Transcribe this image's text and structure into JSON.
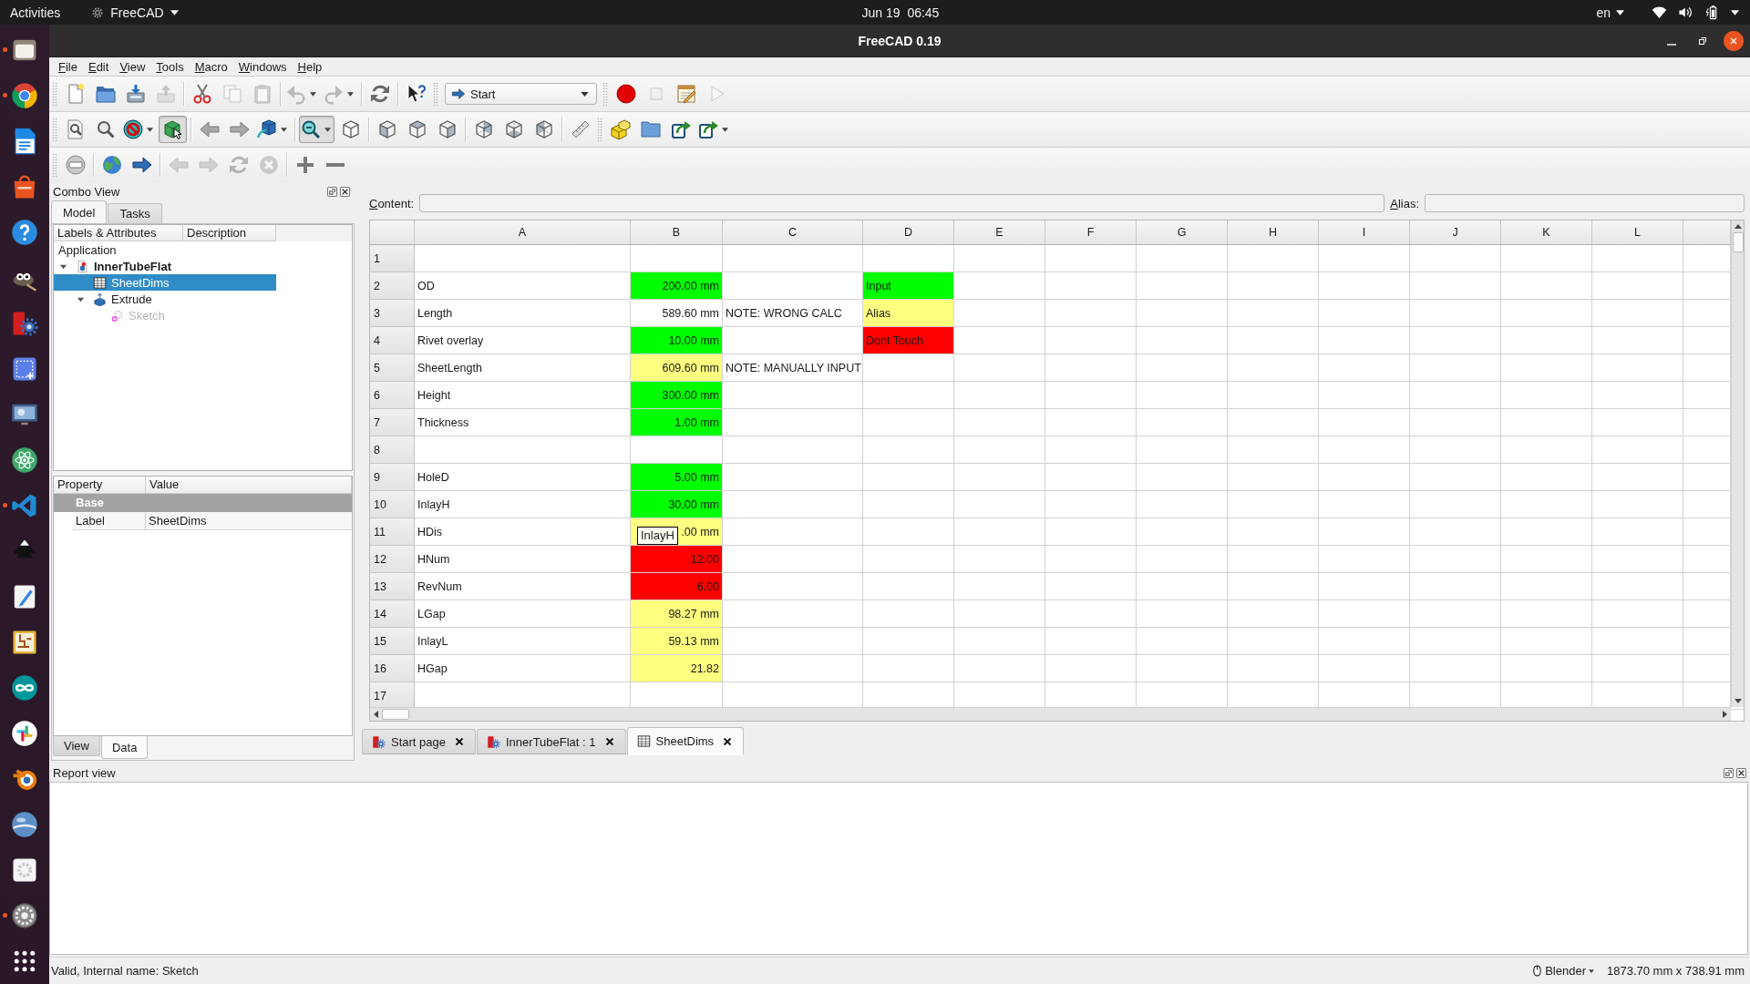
{
  "topbar": {
    "activities": "Activities",
    "app_menu": "FreeCAD",
    "clock": "Jun 19  06:45",
    "language": "en"
  },
  "dock": [
    {
      "kind": "files",
      "running": true
    },
    {
      "kind": "browser",
      "running": true
    },
    {
      "kind": "writer",
      "running": false
    },
    {
      "kind": "software",
      "running": false
    },
    {
      "kind": "help",
      "running": false
    },
    {
      "kind": "gimp",
      "running": false
    },
    {
      "kind": "freecad",
      "running": false
    },
    {
      "kind": "screenshot",
      "running": false
    },
    {
      "kind": "remote",
      "running": false
    },
    {
      "kind": "atom",
      "running": false
    },
    {
      "kind": "vscode",
      "running": true
    },
    {
      "kind": "inkscape",
      "running": false
    },
    {
      "kind": "editor",
      "running": false
    },
    {
      "kind": "kicad",
      "running": false
    },
    {
      "kind": "arduino",
      "running": false
    },
    {
      "kind": "slack",
      "running": false
    },
    {
      "kind": "blender",
      "running": false
    },
    {
      "kind": "earth",
      "running": false
    },
    {
      "kind": "gearbox",
      "running": false
    },
    {
      "kind": "settings",
      "running": true
    },
    {
      "kind": "apps",
      "running": false
    }
  ],
  "window": {
    "title": "FreeCAD 0.19"
  },
  "menu": [
    "File",
    "Edit",
    "View",
    "Tools",
    "Macro",
    "Windows",
    "Help"
  ],
  "toolbar_rows": [
    [
      {
        "groups": [
          [
            {
              "kind": "new",
              "disabled": false,
              "pressed": false,
              "menu": false
            },
            {
              "kind": "open",
              "disabled": false,
              "pressed": false,
              "menu": false
            },
            {
              "kind": "save",
              "disabled": false,
              "pressed": false,
              "menu": false
            },
            {
              "kind": "export",
              "disabled": true,
              "pressed": false,
              "menu": false
            }
          ],
          [
            {
              "kind": "cut",
              "disabled": false,
              "pressed": false,
              "menu": false
            },
            {
              "kind": "copy",
              "disabled": true,
              "pressed": false,
              "menu": false
            },
            {
              "kind": "paste",
              "disabled": true,
              "pressed": false,
              "menu": false
            }
          ],
          [
            {
              "kind": "undo",
              "disabled": true,
              "pressed": false,
              "menu": true
            },
            {
              "kind": "redo",
              "disabled": true,
              "pressed": false,
              "menu": true
            }
          ],
          [
            {
              "kind": "refresh",
              "disabled": false,
              "pressed": false,
              "menu": false
            }
          ],
          [
            {
              "kind": "whats-this",
              "disabled": false,
              "pressed": false,
              "menu": false
            }
          ]
        ]
      },
      {
        "groups": [
          [
            {
              "kind": "combo",
              "value": "Start"
            }
          ]
        ]
      },
      {
        "groups": [
          [
            {
              "kind": "record",
              "disabled": false,
              "pressed": false,
              "menu": false
            },
            {
              "kind": "stop",
              "disabled": true,
              "pressed": false,
              "menu": false
            },
            {
              "kind": "macro-edit",
              "disabled": false,
              "pressed": false,
              "menu": false
            },
            {
              "kind": "play",
              "disabled": true,
              "pressed": false,
              "menu": false
            }
          ]
        ]
      }
    ],
    [
      {
        "groups": [
          [
            {
              "kind": "fit-all",
              "disabled": false,
              "pressed": false,
              "menu": false
            },
            {
              "kind": "fit-selection",
              "disabled": false,
              "pressed": false,
              "menu": false
            },
            {
              "kind": "draw-style",
              "disabled": false,
              "pressed": false,
              "menu": true
            },
            {
              "kind": "bounding-box",
              "disabled": false,
              "pressed": true,
              "menu": false
            }
          ],
          [
            {
              "kind": "back",
              "disabled": false,
              "pressed": false,
              "menu": false
            },
            {
              "kind": "forward",
              "disabled": false,
              "pressed": false,
              "menu": false
            },
            {
              "kind": "std-views",
              "disabled": false,
              "pressed": false,
              "menu": true
            }
          ],
          [
            {
              "kind": "zoom",
              "disabled": false,
              "pressed": true,
              "menu": true
            },
            {
              "kind": "isometric",
              "disabled": false,
              "pressed": false,
              "menu": false
            }
          ],
          [
            {
              "kind": "front",
              "disabled": false,
              "pressed": false,
              "menu": false
            },
            {
              "kind": "top",
              "disabled": false,
              "pressed": false,
              "menu": false
            },
            {
              "kind": "right",
              "disabled": false,
              "pressed": false,
              "menu": false
            }
          ],
          [
            {
              "kind": "rear",
              "disabled": false,
              "pressed": false,
              "menu": false
            },
            {
              "kind": "bottom",
              "disabled": false,
              "pressed": false,
              "menu": false
            },
            {
              "kind": "left",
              "disabled": false,
              "pressed": false,
              "menu": false
            }
          ],
          [
            {
              "kind": "measure",
              "disabled": false,
              "pressed": false,
              "menu": false
            }
          ]
        ]
      },
      {
        "groups": [
          [
            {
              "kind": "part",
              "disabled": false,
              "pressed": false,
              "menu": false
            },
            {
              "kind": "group",
              "disabled": false,
              "pressed": false,
              "menu": false
            },
            {
              "kind": "link",
              "disabled": false,
              "pressed": false,
              "menu": false
            },
            {
              "kind": "link-actions",
              "disabled": false,
              "pressed": false,
              "menu": true
            }
          ]
        ]
      }
    ],
    [
      {
        "groups": [
          [
            {
              "kind": "web-view",
              "disabled": false,
              "pressed": false,
              "menu": false
            }
          ],
          [
            {
              "kind": "globe",
              "disabled": false,
              "pressed": false,
              "menu": false
            },
            {
              "kind": "set-url",
              "disabled": false,
              "pressed": false,
              "menu": false
            }
          ],
          [
            {
              "kind": "web-back",
              "disabled": true,
              "pressed": false,
              "menu": false
            },
            {
              "kind": "web-forward",
              "disabled": true,
              "pressed": false,
              "menu": false
            },
            {
              "kind": "web-refresh",
              "disabled": true,
              "pressed": false,
              "menu": false
            },
            {
              "kind": "web-stop",
              "disabled": true,
              "pressed": false,
              "menu": false
            }
          ],
          [
            {
              "kind": "zoom-in",
              "disabled": false,
              "pressed": false,
              "menu": false
            },
            {
              "kind": "zoom-out",
              "disabled": false,
              "pressed": false,
              "menu": false
            }
          ]
        ]
      }
    ]
  ],
  "combo_view": {
    "title": "Combo View",
    "tabs": [
      {
        "label": "Model",
        "selected": true
      },
      {
        "label": "Tasks",
        "selected": false
      }
    ],
    "tree": {
      "columns": [
        "Labels & Attributes",
        "Description"
      ],
      "root": "Application",
      "items": [
        {
          "label": "InnerTubeFlat",
          "kind": "document",
          "expanded": true,
          "selected": false,
          "hidden": false,
          "children": [
            {
              "label": "SheetDims",
              "kind": "spreadsheet",
              "selected": true,
              "hidden": false
            },
            {
              "label": "Extrude",
              "kind": "extrude",
              "expanded": true,
              "selected": false,
              "hidden": false,
              "children": [
                {
                  "label": "Sketch",
                  "kind": "sketch",
                  "selected": false,
                  "hidden": true
                }
              ]
            }
          ]
        }
      ]
    },
    "properties": {
      "columns": [
        "Property",
        "Value"
      ],
      "groups": [
        {
          "name": "Base",
          "rows": [
            {
              "name": "Label",
              "value": "SheetDims"
            }
          ]
        }
      ]
    },
    "bottom_tabs": [
      {
        "label": "View",
        "selected": false
      },
      {
        "label": "Data",
        "selected": true
      }
    ]
  },
  "spreadsheet": {
    "content_label": "Content:",
    "alias_label": "Alias:",
    "columns": [
      "A",
      "B",
      "C",
      "D",
      "E",
      "F",
      "G",
      "H",
      "I",
      "J",
      "K",
      "L"
    ],
    "rows": [
      {
        "number": "1"
      },
      {
        "number": "2",
        "a": {
          "text": "OD",
          "kind": "text"
        },
        "b": {
          "text": "200.00 mm",
          "kind": "number",
          "color": "#00ff00"
        },
        "d": {
          "text": "Input",
          "kind": "text",
          "color": "#00ff00"
        }
      },
      {
        "number": "3",
        "a": {
          "text": "Length",
          "kind": "text"
        },
        "b": {
          "text": "589.60 mm",
          "kind": "number"
        },
        "c": {
          "text": "NOTE: WRONG CALC",
          "kind": "text"
        },
        "d": {
          "text": "Alias",
          "kind": "text",
          "color": "#ffff80"
        }
      },
      {
        "number": "4",
        "a": {
          "text": "Rivet overlay",
          "kind": "text"
        },
        "b": {
          "text": "10.00 mm",
          "kind": "number",
          "color": "#00ff00"
        },
        "d": {
          "text": "Dont Touch",
          "kind": "text",
          "color": "#ff0000"
        }
      },
      {
        "number": "5",
        "a": {
          "text": "SheetLength",
          "kind": "text"
        },
        "b": {
          "text": "609.60 mm",
          "kind": "number",
          "color": "#ffff80"
        },
        "c": {
          "text": "NOTE: MANUALLY INPUT",
          "kind": "text"
        }
      },
      {
        "number": "6",
        "a": {
          "text": "Height",
          "kind": "text"
        },
        "b": {
          "text": "300.00 mm",
          "kind": "number",
          "color": "#00ff00"
        }
      },
      {
        "number": "7",
        "a": {
          "text": "Thickness",
          "kind": "text"
        },
        "b": {
          "text": "1.00 mm",
          "kind": "number",
          "color": "#00ff00"
        }
      },
      {
        "number": "8"
      },
      {
        "number": "9",
        "a": {
          "text": "HoleD",
          "kind": "text"
        },
        "b": {
          "text": "5.00 mm",
          "kind": "number",
          "color": "#00ff00"
        }
      },
      {
        "number": "10",
        "a": {
          "text": "InlayH",
          "kind": "text"
        },
        "b": {
          "text": "30.00 mm",
          "kind": "number",
          "color": "#00ff00"
        }
      },
      {
        "number": "11",
        "a": {
          "text": "HDis",
          "kind": "text"
        },
        "b": {
          "text": ".00 mm",
          "kind": "number",
          "color": "#ffff80",
          "tooltip": "InlayH"
        }
      },
      {
        "number": "12",
        "a": {
          "text": "HNum",
          "kind": "text"
        },
        "b": {
          "text": "12.00",
          "kind": "number",
          "color": "#ff0000"
        }
      },
      {
        "number": "13",
        "a": {
          "text": "RevNum",
          "kind": "text"
        },
        "b": {
          "text": "6.00",
          "kind": "number",
          "color": "#ff0000"
        }
      },
      {
        "number": "14",
        "a": {
          "text": "LGap",
          "kind": "text"
        },
        "b": {
          "text": "98.27 mm",
          "kind": "number",
          "color": "#ffff80"
        }
      },
      {
        "number": "15",
        "a": {
          "text": "InlayL",
          "kind": "text"
        },
        "b": {
          "text": "59.13 mm",
          "kind": "number",
          "color": "#ffff80"
        }
      },
      {
        "number": "16",
        "a": {
          "text": "HGap",
          "kind": "text"
        },
        "b": {
          "text": "21.82",
          "kind": "number",
          "color": "#ffff80"
        }
      },
      {
        "number": "17"
      }
    ]
  },
  "document_tabs": [
    {
      "label": "Start page",
      "kind": "start",
      "selected": false
    },
    {
      "label": "InnerTubeFlat : 1",
      "kind": "view3d",
      "selected": false
    },
    {
      "label": "SheetDims",
      "kind": "spreadsheet",
      "selected": true
    }
  ],
  "report_view": {
    "title": "Report view"
  },
  "status_bar": {
    "message": "Valid, Internal name: Sketch",
    "navigation": "Blender",
    "dimensions": "1873.70 mm x 738.91 mm"
  }
}
